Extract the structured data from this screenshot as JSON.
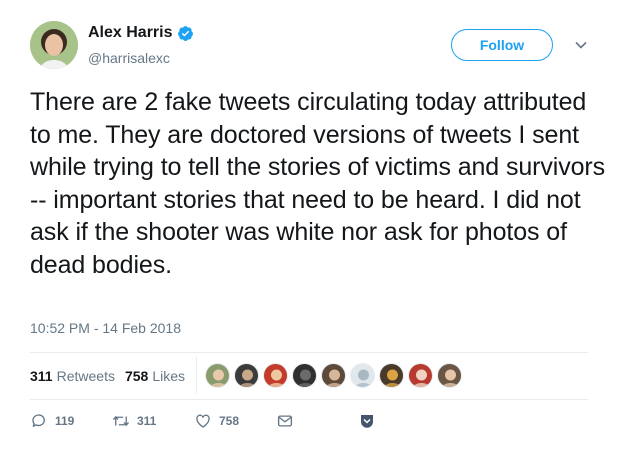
{
  "author": {
    "name": "Alex Harris",
    "handle": "@harrisalexc",
    "verified": true
  },
  "follow_label": "Follow",
  "tweet": {
    "text": "There are 2 fake tweets circulating today attributed to me. They are doctored versions of tweets I sent while trying to tell the stories of victims and survivors -- important stories that need to be heard. I did not ask if the shooter was white nor ask for photos of dead bodies.",
    "timestamp": "10:52 PM - 14 Feb 2018"
  },
  "stats": {
    "retweets_count": "311",
    "retweets_label": "Retweets",
    "likes_count": "758",
    "likes_label": "Likes"
  },
  "liker_avatars": [
    {
      "bg": "#8a9b6e",
      "fg": "#e8c9a9"
    },
    {
      "bg": "#3b3b3b",
      "fg": "#c9a88a"
    },
    {
      "bg": "#c23b2b",
      "fg": "#f0c8a0"
    },
    {
      "bg": "#2f2f2f",
      "fg": "#6b6b6b"
    },
    {
      "bg": "#5e4a3a",
      "fg": "#d7b79a"
    },
    {
      "bg": "#e1e8ed",
      "fg": "#aab8c2"
    },
    {
      "bg": "#4a3a2a",
      "fg": "#d9a441"
    },
    {
      "bg": "#b83a2e",
      "fg": "#efd3c0"
    },
    {
      "bg": "#6b5544",
      "fg": "#e6c5a8"
    }
  ],
  "actions": {
    "reply_count": "119",
    "retweet_count": "311",
    "like_count": "758"
  },
  "colors": {
    "accent": "#1da1f2",
    "text": "#14171a",
    "secondary": "#657786",
    "border": "#e6ecf0"
  },
  "icons": [
    "verified-badge-icon",
    "chevron-down-icon",
    "reply-icon",
    "retweet-icon",
    "like-icon",
    "message-icon",
    "bookmark-shield-icon"
  ]
}
